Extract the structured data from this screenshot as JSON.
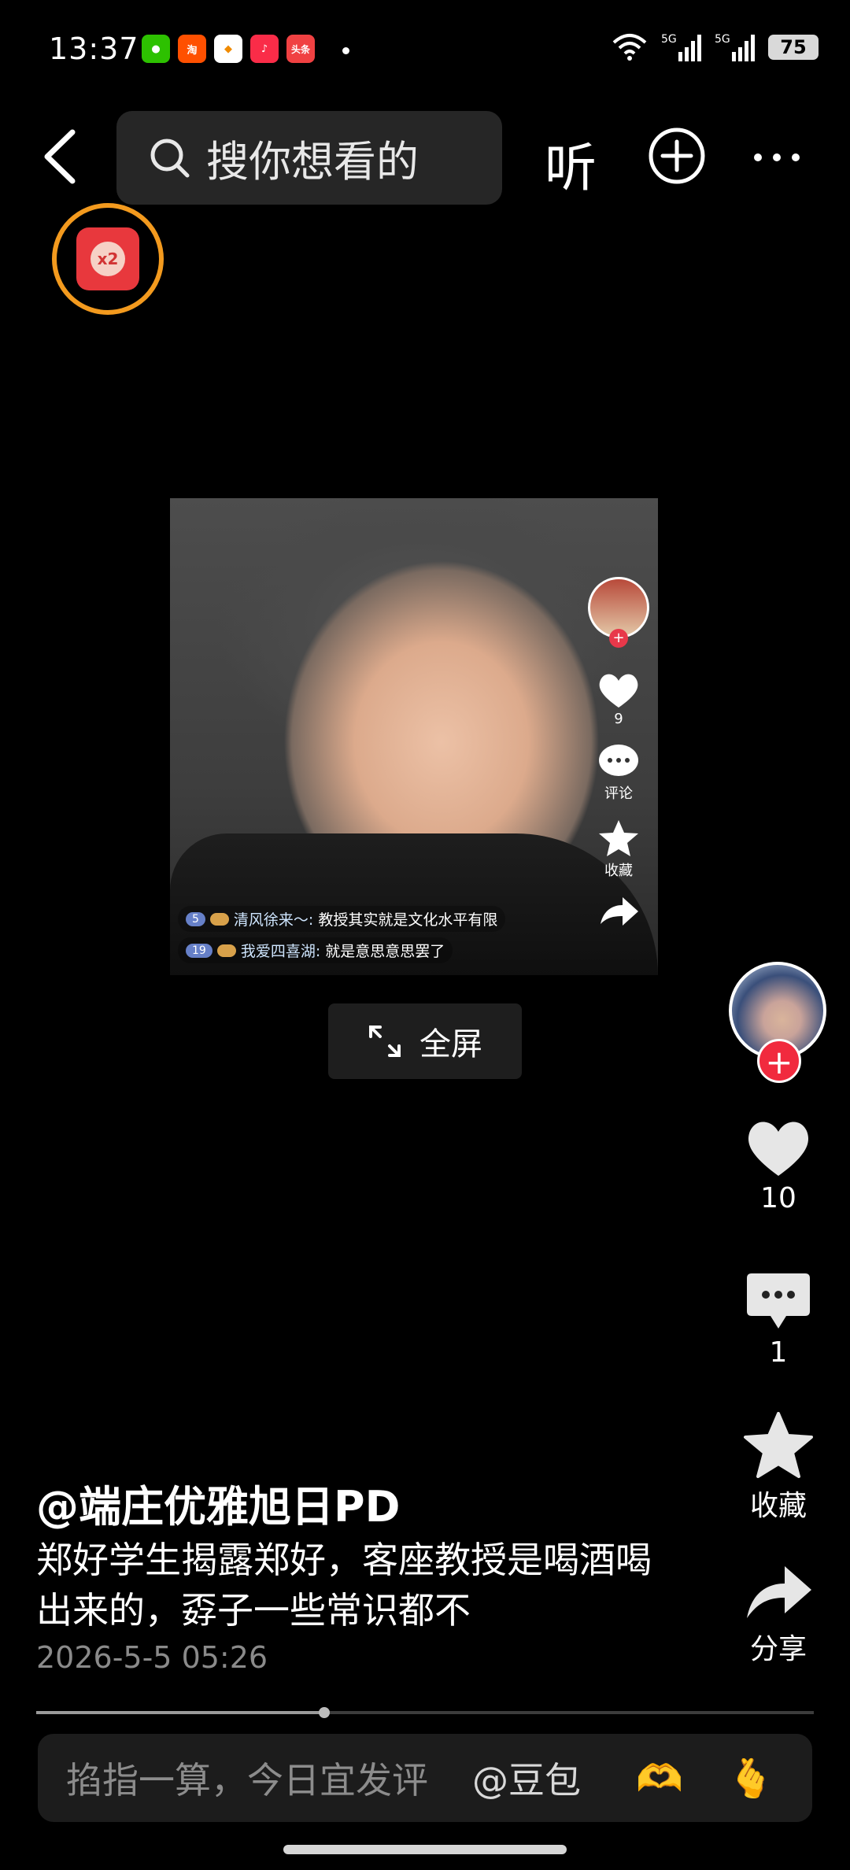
{
  "status_bar": {
    "time": "13:37",
    "apps": [
      "wechat",
      "taobao",
      "alipay-mini",
      "music",
      "toutiao"
    ],
    "toutiao_label": "头条",
    "network": "5G",
    "battery": "75"
  },
  "top_nav": {
    "search_placeholder": "搜你想看的",
    "listen_label": "听"
  },
  "red_packet": {
    "multiplier": "x2"
  },
  "video": {
    "side": {
      "like_count": "9",
      "comment_label": "评论",
      "favorite_label": "收藏"
    },
    "chat": [
      {
        "level": "5",
        "name": "清风徐来～:",
        "text": "教授其实就是文化水平有限"
      },
      {
        "level": "19",
        "name": "我爱四喜湖:",
        "text": "就是意思意思罢了"
      }
    ]
  },
  "fullscreen_label": "全屏",
  "actions": {
    "like_count": "10",
    "comment_count": "1",
    "favorite_label": "收藏",
    "share_label": "分享"
  },
  "post": {
    "author": "@端庄优雅旭日PD",
    "description": "郑好学生揭露郑好，客座教授是喝酒喝出来的，孬子一些常识都不",
    "date": "2026-5-5 05:26"
  },
  "playback": {
    "progress": 0.37
  },
  "comment_bar": {
    "placeholder": "掐指一算，今日宜发评",
    "mention": "@豆包",
    "emoji_1": "🫶",
    "emoji_2": "🫰"
  }
}
